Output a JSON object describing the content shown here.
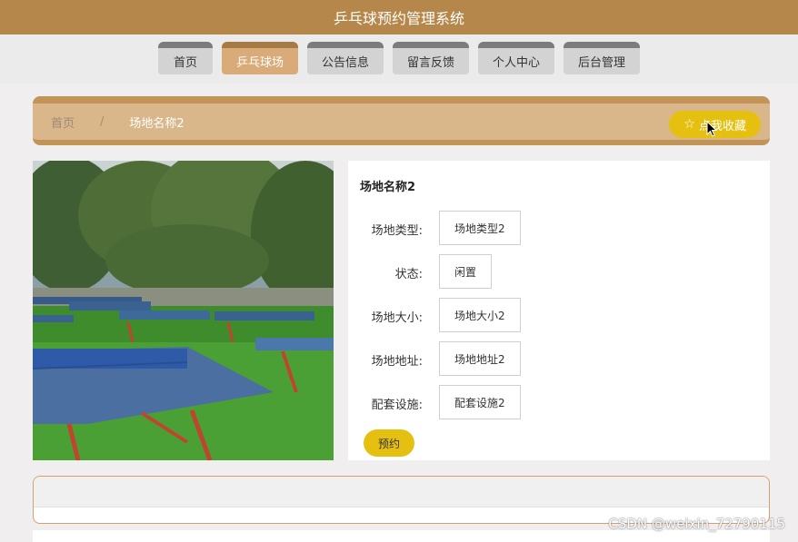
{
  "app": {
    "title": "乒乓球预约管理系统"
  },
  "nav": {
    "items": [
      {
        "label": "首页"
      },
      {
        "label": "乒乓球场"
      },
      {
        "label": "公告信息"
      },
      {
        "label": "留言反馈"
      },
      {
        "label": "个人中心"
      },
      {
        "label": "后台管理"
      }
    ],
    "active_index": 1
  },
  "breadcrumb": {
    "home": "首页",
    "separator": "/",
    "current": "场地名称2"
  },
  "favorite_button": {
    "icon": "star-icon",
    "label": "点我收藏"
  },
  "detail": {
    "title": "场地名称2",
    "fields": [
      {
        "label": "场地类型:",
        "value": "场地类型2"
      },
      {
        "label": "状态:",
        "value": "闲置"
      },
      {
        "label": "场地大小:",
        "value": "场地大小2"
      },
      {
        "label": "场地地址:",
        "value": "场地地址2"
      },
      {
        "label": "配套设施:",
        "value": "配套设施2"
      }
    ],
    "book_label": "预约"
  },
  "watermark": "CSDN @weixin_72790115",
  "colors": {
    "brand": "#b6874a",
    "accent": "#e6c010",
    "nav_active": "#d9ab78"
  }
}
